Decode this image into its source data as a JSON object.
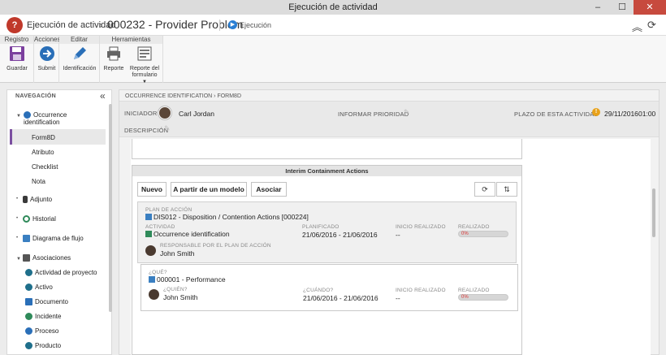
{
  "window": {
    "title": "Ejecución de actividad",
    "min": "–",
    "max": "☐",
    "close": "✕"
  },
  "header": {
    "app_title": "Ejecución de actividad",
    "record_title": "000232 - Provider Problem",
    "status": "Ejecución",
    "logo_glyph": "?"
  },
  "ribbon": {
    "groups": [
      {
        "label": "Registro",
        "buttons": [
          {
            "label": "Guardar",
            "icon": "save-icon"
          }
        ]
      },
      {
        "label": "Acciones",
        "buttons": [
          {
            "label": "Submit",
            "icon": "submit-arrow-icon"
          }
        ]
      },
      {
        "label": "Editar",
        "buttons": [
          {
            "label": "Identificación",
            "icon": "pencil-icon"
          }
        ]
      },
      {
        "label": "Herramientas",
        "buttons": [
          {
            "label": "Reporte",
            "icon": "printer-icon"
          },
          {
            "label": "Reporte del formulario",
            "icon": "form-report-icon"
          }
        ]
      }
    ]
  },
  "sidebar": {
    "heading": "NAVEGACIÓN",
    "items": [
      {
        "label": "Occurrence identification",
        "icon": "play-circle-icon"
      },
      {
        "label": "Form8D"
      },
      {
        "label": "Atributo"
      },
      {
        "label": "Checklist"
      },
      {
        "label": "Nota"
      },
      {
        "label": "Adjunto",
        "icon": "paperclip-icon"
      },
      {
        "label": "Historial",
        "icon": "history-icon"
      },
      {
        "label": "Diagrama de flujo",
        "icon": "flow-icon"
      },
      {
        "label": "Asociaciones",
        "icon": "folder-icon"
      },
      {
        "label": "Actividad de proyecto",
        "icon": "project-icon"
      },
      {
        "label": "Activo",
        "icon": "asset-icon"
      },
      {
        "label": "Documento",
        "icon": "document-icon"
      },
      {
        "label": "Incidente",
        "icon": "incident-icon"
      },
      {
        "label": "Proceso",
        "icon": "process-icon"
      },
      {
        "label": "Producto",
        "icon": "product-icon"
      }
    ]
  },
  "breadcrumb": {
    "first": "OCCURRENCE IDENTIFICATION",
    "second": "FORM8D"
  },
  "info": {
    "initiator_label": "INICIADOR",
    "initiator": "Carl Jordan",
    "priority_label": "INFORMAR PRIORIDAD",
    "deadline_label": "PLAZO DE ESTA ACTIVIDAD",
    "deadline": "29/11/2016",
    "deadline_time": "01:00",
    "description_label": "DESCRIPCIÓN"
  },
  "section": {
    "title": "Interim Containment Actions",
    "buttons": {
      "new": "Nuevo",
      "from_model": "A partir de un modelo",
      "associate": "Asociar"
    }
  },
  "plan": {
    "label": "PLAN DE ACCIÓN",
    "value": "DIS012 - Disposition / Contention Actions [000224]",
    "activity_label": "ACTIVIDAD",
    "activity": "Occurrence identification",
    "planned_label": "PLANIFICADO",
    "planned": "21/06/2016 - 21/06/2016",
    "start_label": "INICIO REALIZADO",
    "start": "--",
    "done_label": "REALIZADO",
    "done": "0%",
    "done_value": 0,
    "owner_label": "RESPONSABLE POR EL PLAN DE ACCIÓN",
    "owner": "John Smith"
  },
  "action": {
    "what_label": "¿QUÉ?",
    "what": "000001 - Performance",
    "who_label": "¿QUIÉN?",
    "who": "John Smith",
    "when_label": "¿CUÁNDO?",
    "when": "21/06/2016 - 21/06/2016",
    "start_label": "INICIO REALIZADO",
    "start": "--",
    "done_label": "REALIZADO",
    "done": "0%",
    "done_value": 0
  }
}
